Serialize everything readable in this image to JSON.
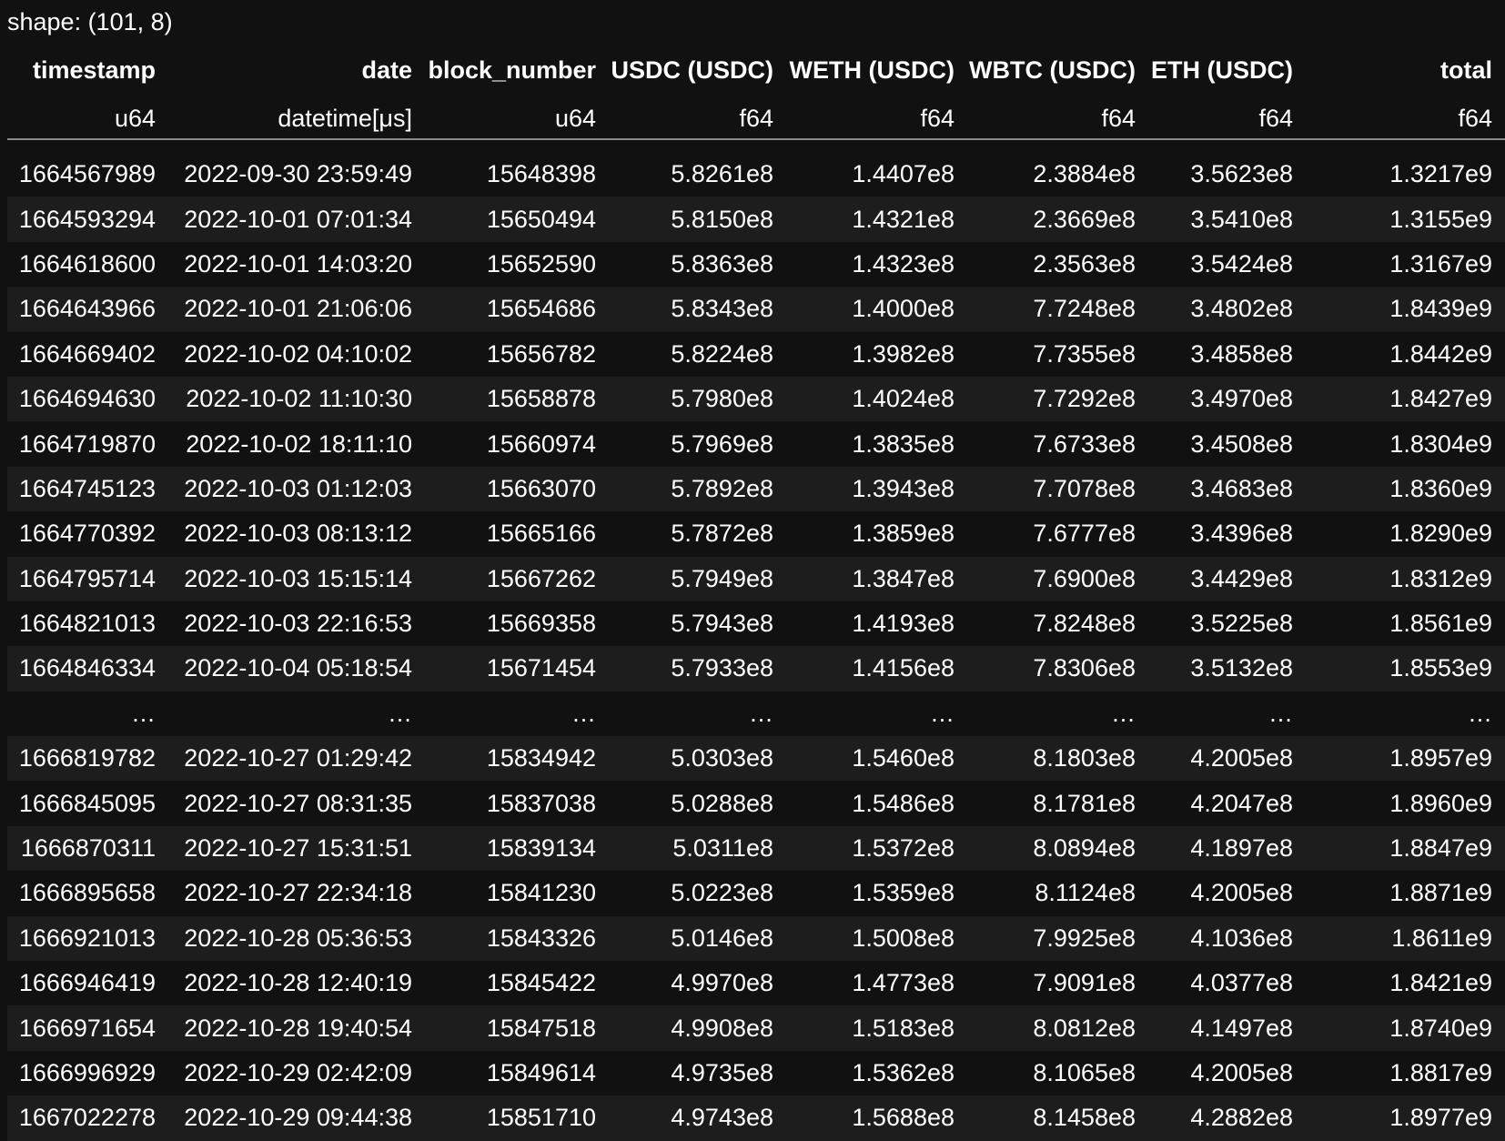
{
  "shape_text": "shape: (101, 8)",
  "table": {
    "columns": [
      {
        "name": "timestamp",
        "dtype": "u64"
      },
      {
        "name": "date",
        "dtype": "datetime[μs]"
      },
      {
        "name": "block_number",
        "dtype": "u64"
      },
      {
        "name": "USDC (USDC)",
        "dtype": "f64"
      },
      {
        "name": "WETH (USDC)",
        "dtype": "f64"
      },
      {
        "name": "WBTC (USDC)",
        "dtype": "f64"
      },
      {
        "name": "ETH (USDC)",
        "dtype": "f64"
      },
      {
        "name": "total",
        "dtype": "f64"
      }
    ],
    "rows": [
      [
        "1664567989",
        "2022-09-30 23:59:49",
        "15648398",
        "5.8261e8",
        "1.4407e8",
        "2.3884e8",
        "3.5623e8",
        "1.3217e9"
      ],
      [
        "1664593294",
        "2022-10-01 07:01:34",
        "15650494",
        "5.8150e8",
        "1.4321e8",
        "2.3669e8",
        "3.5410e8",
        "1.3155e9"
      ],
      [
        "1664618600",
        "2022-10-01 14:03:20",
        "15652590",
        "5.8363e8",
        "1.4323e8",
        "2.3563e8",
        "3.5424e8",
        "1.3167e9"
      ],
      [
        "1664643966",
        "2022-10-01 21:06:06",
        "15654686",
        "5.8343e8",
        "1.4000e8",
        "7.7248e8",
        "3.4802e8",
        "1.8439e9"
      ],
      [
        "1664669402",
        "2022-10-02 04:10:02",
        "15656782",
        "5.8224e8",
        "1.3982e8",
        "7.7355e8",
        "3.4858e8",
        "1.8442e9"
      ],
      [
        "1664694630",
        "2022-10-02 11:10:30",
        "15658878",
        "5.7980e8",
        "1.4024e8",
        "7.7292e8",
        "3.4970e8",
        "1.8427e9"
      ],
      [
        "1664719870",
        "2022-10-02 18:11:10",
        "15660974",
        "5.7969e8",
        "1.3835e8",
        "7.6733e8",
        "3.4508e8",
        "1.8304e9"
      ],
      [
        "1664745123",
        "2022-10-03 01:12:03",
        "15663070",
        "5.7892e8",
        "1.3943e8",
        "7.7078e8",
        "3.4683e8",
        "1.8360e9"
      ],
      [
        "1664770392",
        "2022-10-03 08:13:12",
        "15665166",
        "5.7872e8",
        "1.3859e8",
        "7.6777e8",
        "3.4396e8",
        "1.8290e9"
      ],
      [
        "1664795714",
        "2022-10-03 15:15:14",
        "15667262",
        "5.7949e8",
        "1.3847e8",
        "7.6900e8",
        "3.4429e8",
        "1.8312e9"
      ],
      [
        "1664821013",
        "2022-10-03 22:16:53",
        "15669358",
        "5.7943e8",
        "1.4193e8",
        "7.8248e8",
        "3.5225e8",
        "1.8561e9"
      ],
      [
        "1664846334",
        "2022-10-04 05:18:54",
        "15671454",
        "5.7933e8",
        "1.4156e8",
        "7.8306e8",
        "3.5132e8",
        "1.8553e9"
      ],
      [
        "…",
        "…",
        "…",
        "…",
        "…",
        "…",
        "…",
        "…"
      ],
      [
        "1666819782",
        "2022-10-27 01:29:42",
        "15834942",
        "5.0303e8",
        "1.5460e8",
        "8.1803e8",
        "4.2005e8",
        "1.8957e9"
      ],
      [
        "1666845095",
        "2022-10-27 08:31:35",
        "15837038",
        "5.0288e8",
        "1.5486e8",
        "8.1781e8",
        "4.2047e8",
        "1.8960e9"
      ],
      [
        "1666870311",
        "2022-10-27 15:31:51",
        "15839134",
        "5.0311e8",
        "1.5372e8",
        "8.0894e8",
        "4.1897e8",
        "1.8847e9"
      ],
      [
        "1666895658",
        "2022-10-27 22:34:18",
        "15841230",
        "5.0223e8",
        "1.5359e8",
        "8.1124e8",
        "4.2005e8",
        "1.8871e9"
      ],
      [
        "1666921013",
        "2022-10-28 05:36:53",
        "15843326",
        "5.0146e8",
        "1.5008e8",
        "7.9925e8",
        "4.1036e8",
        "1.8611e9"
      ],
      [
        "1666946419",
        "2022-10-28 12:40:19",
        "15845422",
        "4.9970e8",
        "1.4773e8",
        "7.9091e8",
        "4.0377e8",
        "1.8421e9"
      ],
      [
        "1666971654",
        "2022-10-28 19:40:54",
        "15847518",
        "4.9908e8",
        "1.5183e8",
        "8.0812e8",
        "4.1497e8",
        "1.8740e9"
      ],
      [
        "1666996929",
        "2022-10-29 02:42:09",
        "15849614",
        "4.9735e8",
        "1.5362e8",
        "8.1065e8",
        "4.2005e8",
        "1.8817e9"
      ],
      [
        "1667022278",
        "2022-10-29 09:44:38",
        "15851710",
        "4.9743e8",
        "1.5688e8",
        "8.1458e8",
        "4.2882e8",
        "1.8977e9"
      ]
    ]
  }
}
